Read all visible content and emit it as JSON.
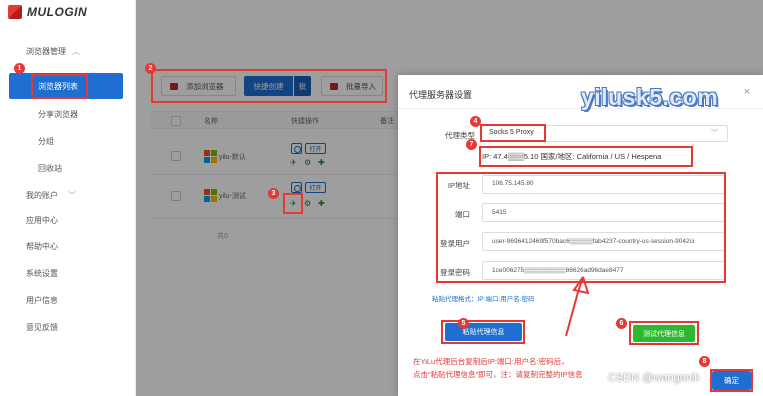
{
  "app": {
    "logo_text": "MULOGIN"
  },
  "sidebar": {
    "group_label": "浏览器管理",
    "active_item": "浏览器列表",
    "sub_items": [
      "分享浏览器",
      "分组",
      "回收站"
    ],
    "top_items": [
      "我的账户",
      "应用中心",
      "帮助中心",
      "系统设置",
      "用户信息",
      "意见反馈"
    ]
  },
  "toolbar": {
    "add_browser": "添加浏览器",
    "quick_create": "快捷创建",
    "batch": "批",
    "batch_import": "批量导入"
  },
  "table": {
    "headers": [
      "名称",
      "快捷操作",
      "备注"
    ],
    "rows": [
      {
        "name": "yilu-默认",
        "open": "打开"
      },
      {
        "name": "yilu-测试",
        "open": "打开"
      }
    ],
    "pager": "共0"
  },
  "modal": {
    "title": "代理服务器设置",
    "close": "×",
    "proxy_type_label": "代理类型",
    "proxy_type_value": "Socks 5 Proxy",
    "ip_info": "IP: 47.4▒▒▒5.10   国家/地区: California / US / Hespena",
    "fields": [
      {
        "label": "IP地址",
        "value": "106.75.145.80"
      },
      {
        "label": "端口",
        "value": "5415"
      },
      {
        "label": "登录用户",
        "value": "user-9696412469f570bac6▒▒▒▒▒fab4237-country-us-session-9042ci"
      },
      {
        "label": "登录密码",
        "value": "1ce006275▒▒▒▒▒▒▒▒▒86626ad96dae8477"
      }
    ],
    "paste_hint": "粘贴代理格式：IP:端口:用户名:密码",
    "paste_button": "粘贴代理信息",
    "test_button": "测试代理信息",
    "confirm_button": "确定",
    "watermark": "yilusk5.com"
  },
  "annotations": {
    "badges": [
      "1",
      "2",
      "3",
      "4",
      "5",
      "6",
      "7",
      "8"
    ],
    "note_line1": "在YiLu代理后台复制后IP:端口:用户名:密码后，",
    "note_line2": "点击“粘贴代理信息”即可，注：请复制完整的IP信息"
  },
  "footer": {
    "csdn": "CSDN @wangonik"
  },
  "colors": {
    "accent": "#1e6fd1",
    "annotation_red": "#e53935",
    "test_green": "#2eb82e"
  },
  "icons": [
    "logo-mark",
    "windows-logo-icon",
    "open-browser-icon",
    "rocket-icon",
    "settings-icon",
    "puzzle-icon",
    "chevron-down-icon",
    "close-icon"
  ]
}
